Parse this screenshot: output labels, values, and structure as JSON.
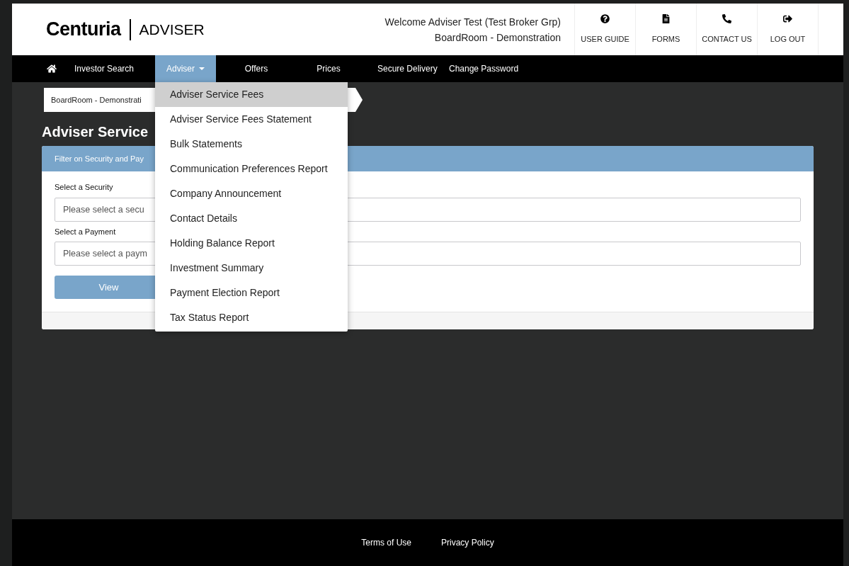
{
  "header": {
    "logo": "Centuria",
    "product": "ADVISER",
    "welcome": "Welcome Adviser Test (Test Broker Grp)",
    "account": "BoardRoom - Demonstration",
    "actions": [
      {
        "kind": "guide",
        "label": "USER GUIDE"
      },
      {
        "kind": "forms",
        "label": "FORMS"
      },
      {
        "kind": "contact",
        "label": "CONTACT US"
      },
      {
        "kind": "logout",
        "label": "LOG OUT"
      }
    ]
  },
  "nav": [
    {
      "label": "Investor Search",
      "selected": false,
      "dropdown": false
    },
    {
      "label": "Adviser",
      "selected": true,
      "dropdown": true
    },
    {
      "label": "Offers",
      "selected": false,
      "dropdown": false
    },
    {
      "label": "Prices",
      "selected": false,
      "dropdown": false
    },
    {
      "label": "Secure Delivery",
      "selected": false,
      "dropdown": false
    },
    {
      "label": "Change Password",
      "selected": false,
      "dropdown": false
    }
  ],
  "menu": [
    {
      "label": "Adviser Service Fees",
      "selected": true
    },
    {
      "label": "Adviser Service Fees Statement",
      "selected": false
    },
    {
      "label": "Bulk Statements",
      "selected": false
    },
    {
      "label": "Communication Preferences Report",
      "selected": false
    },
    {
      "label": "Company Announcement",
      "selected": false
    },
    {
      "label": "Contact Details",
      "selected": false
    },
    {
      "label": "Holding Balance Report",
      "selected": false
    },
    {
      "label": "Investment Summary",
      "selected": false
    },
    {
      "label": "Payment Election Report",
      "selected": false
    },
    {
      "label": "Tax Status Report",
      "selected": false
    }
  ],
  "breadcrumb": "BoardRoom - Demonstrati",
  "page_title": "Adviser Service",
  "panel": {
    "title": "Filter on Security and Pay",
    "fields": [
      {
        "label": "Select a Security",
        "placeholder": "Please select a secu"
      },
      {
        "label": "Select a Payment",
        "placeholder": "Please select a paym"
      }
    ],
    "button": "View"
  },
  "footer": [
    "Terms of Use",
    "Privacy Policy"
  ]
}
